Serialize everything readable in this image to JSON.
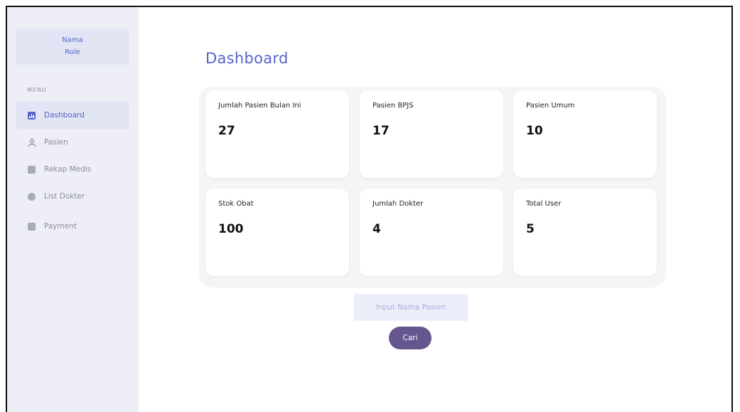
{
  "sidebar": {
    "profile": {
      "name": "Nama",
      "role": "Role"
    },
    "menu_label": "MENU",
    "items": [
      {
        "label": "Dashboard",
        "icon": "bar-chart-icon",
        "active": true
      },
      {
        "label": "Pasien",
        "icon": "user-icon",
        "active": false
      },
      {
        "label": "Rekap Medis",
        "icon": "document-icon",
        "active": false
      },
      {
        "label": "List Dokter",
        "icon": "chat-icon",
        "active": false
      },
      {
        "label": "Payment",
        "icon": "wallet-icon",
        "active": false
      }
    ]
  },
  "main": {
    "title": "Dashboard",
    "cards": [
      {
        "label": "Jumlah Pasien Bulan Ini",
        "value": "27"
      },
      {
        "label": "Pasien BPJS",
        "value": "17"
      },
      {
        "label": "Pasien Umum",
        "value": "10"
      },
      {
        "label": "Stok Obat",
        "value": "100"
      },
      {
        "label": "Jumlah Dokter",
        "value": "4"
      },
      {
        "label": "Total User",
        "value": "5"
      }
    ],
    "search": {
      "placeholder": "Input Nama Pasien",
      "button_label": "Cari"
    }
  },
  "colors": {
    "accent": "#5563c8",
    "sidebar_bg": "#eeeff6",
    "button_bg": "#66568f"
  }
}
